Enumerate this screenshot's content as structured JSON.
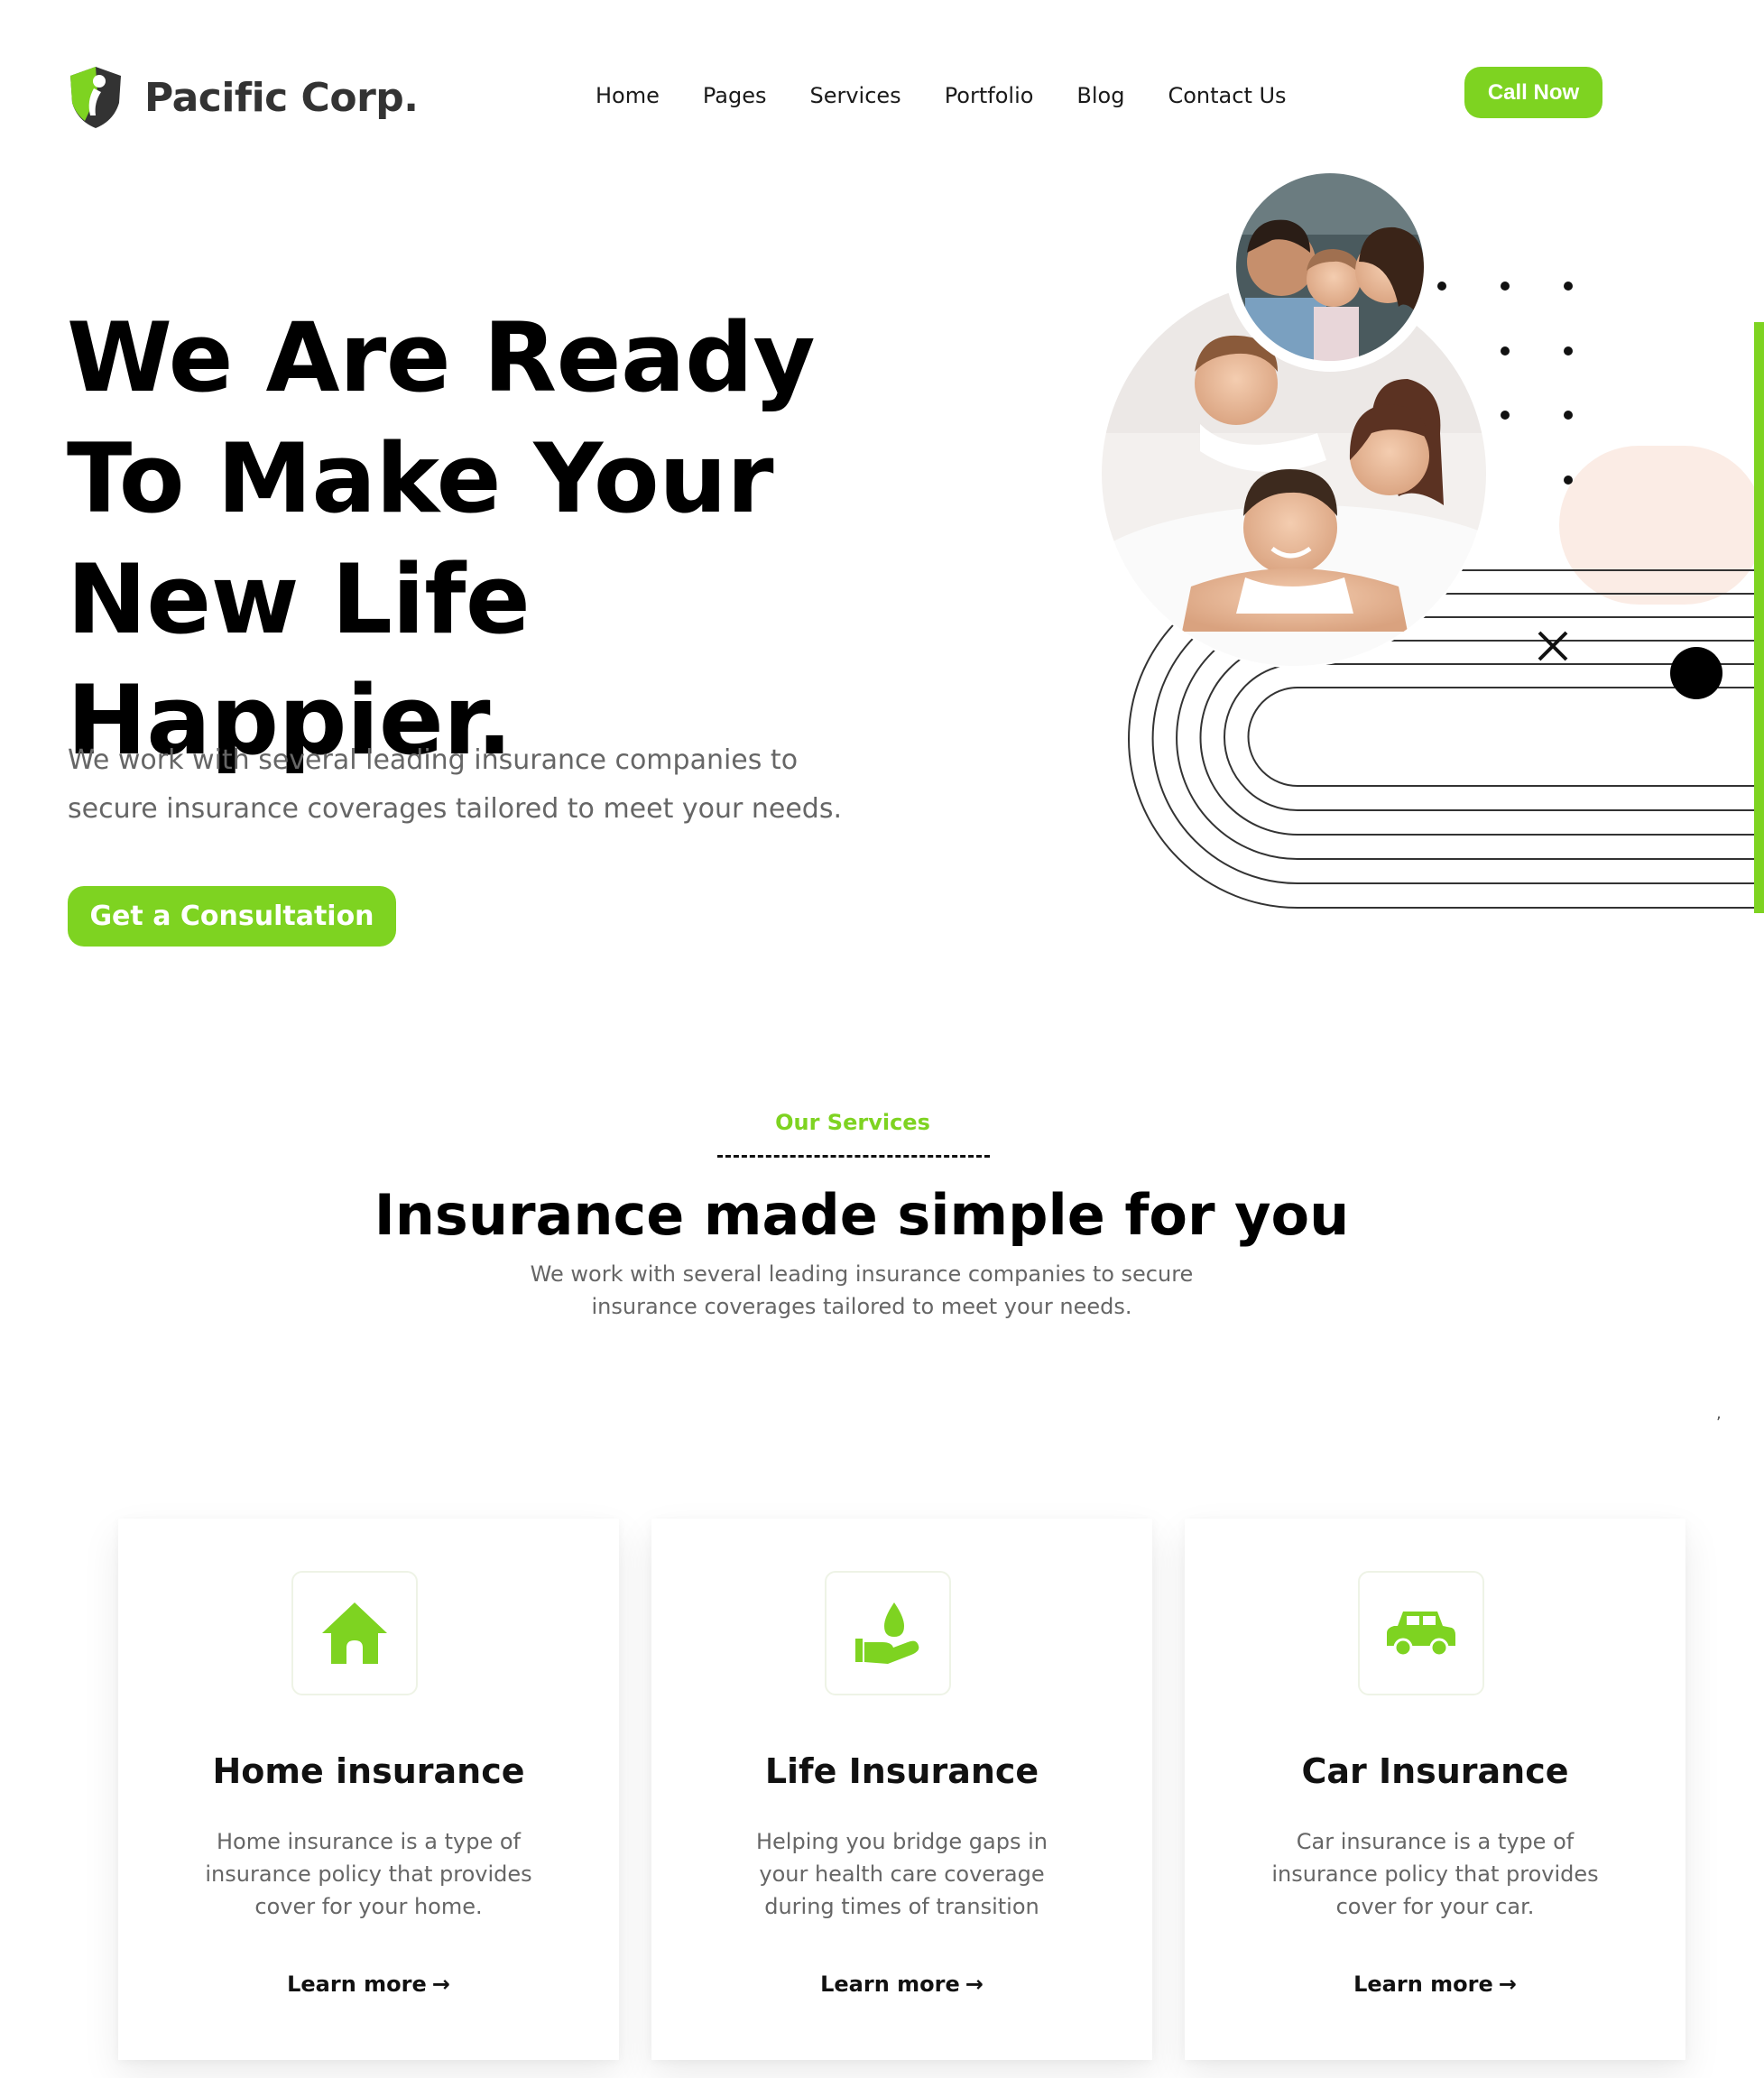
{
  "header": {
    "logo_text": "Pacific Corp.",
    "nav": [
      "Home",
      "Pages",
      "Services",
      "Portfolio",
      "Blog",
      "Contact Us"
    ],
    "call_button": "Call Now"
  },
  "hero": {
    "title": "We Are Ready To Make Your New Life Happier.",
    "subtitle": "We work with several leading insurance companies to secure insurance coverages tailored to meet your needs.",
    "cta": "Get a Consultation"
  },
  "services": {
    "eyebrow": "Our Services",
    "title": "Insurance made simple for you",
    "subtitle": "We work with several leading insurance companies to secure insurance coverages tailored to meet your needs.",
    "cards": [
      {
        "icon": "house-icon",
        "title": "Home insurance",
        "text": "Home insurance is a type of insurance policy that provides cover for your home.",
        "link": "Learn more"
      },
      {
        "icon": "hand-drop-icon",
        "title": "Life Insurance",
        "text": "Helping you bridge gaps in your health care coverage during times of transition",
        "link": "Learn more"
      },
      {
        "icon": "car-icon",
        "title": "Car Insurance",
        "text": "Car insurance is a type of insurance policy that provides cover for your car.",
        "link": "Learn more"
      }
    ]
  },
  "colors": {
    "accent": "#7ed321",
    "text": "#111111",
    "muted": "#666666",
    "peach": "#fbece5"
  }
}
